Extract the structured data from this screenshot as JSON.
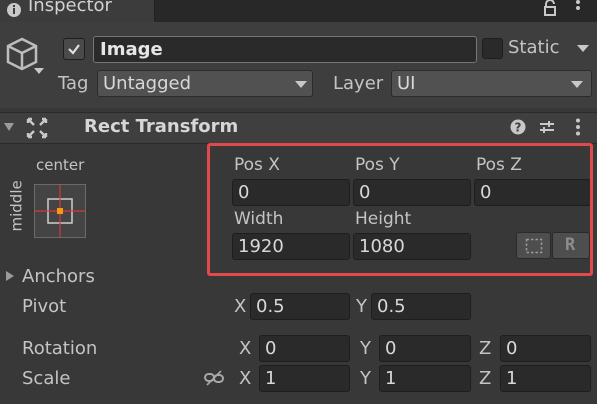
{
  "window": {
    "tab_title": "Inspector"
  },
  "header": {
    "object_name": "Image",
    "active_checked": true,
    "static_label": "Static",
    "tag_label": "Tag",
    "tag_value": "Untagged",
    "layer_label": "Layer",
    "layer_value": "UI"
  },
  "component": {
    "title": "Rect Transform"
  },
  "anchor_preset": {
    "horizontal": "center",
    "vertical": "middle"
  },
  "fields": {
    "pos_x_label": "Pos X",
    "pos_y_label": "Pos Y",
    "pos_z_label": "Pos Z",
    "pos_x": "0",
    "pos_y": "0",
    "pos_z": "0",
    "width_label": "Width",
    "height_label": "Height",
    "width": "1920",
    "height": "1080"
  },
  "anchors_label": "Anchors",
  "pivot": {
    "label": "Pivot",
    "x_label": "X",
    "x": "0.5",
    "y_label": "Y",
    "y": "0.5"
  },
  "rotation": {
    "label": "Rotation",
    "x_label": "X",
    "x": "0",
    "y_label": "Y",
    "y": "0",
    "z_label": "Z",
    "z": "0"
  },
  "scale": {
    "label": "Scale",
    "x_label": "X",
    "x": "1",
    "y_label": "Y",
    "y": "1",
    "z_label": "Z",
    "z": "1"
  },
  "icons": {
    "tab": "info-icon",
    "lock": "lock-icon",
    "menu": "kebab-menu-icon",
    "object": "cube-icon",
    "component": "rect-transform-icon",
    "help": "help-icon",
    "presets": "presets-icon",
    "blueprint": "blueprint-mode-icon",
    "raw": "raw-edit-icon",
    "link": "link-icon"
  },
  "colors": {
    "highlight_border": "#e04a4a",
    "anchor_cross": "#d9363e",
    "anchor_center": "#f39c12"
  }
}
